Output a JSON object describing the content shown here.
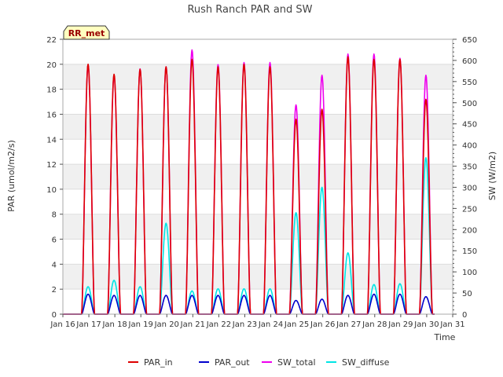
{
  "chart_data": {
    "type": "line",
    "title": "Rush Ranch PAR and SW",
    "badge": "RR_met",
    "xlabel": "Time",
    "ylabel": "PAR (umol/m2/s)",
    "y2label": "SW (W/m2)",
    "xlim": [
      16,
      31
    ],
    "ylim": [
      0,
      22
    ],
    "y2lim": [
      0,
      650
    ],
    "xticks": [
      16,
      17,
      18,
      19,
      20,
      21,
      22,
      23,
      24,
      25,
      26,
      27,
      28,
      29,
      30,
      31
    ],
    "xtick_labels": [
      "Jan 16",
      "Jan 17",
      "Jan 18",
      "Jan 19",
      "Jan 20",
      "Jan 21",
      "Jan 22",
      "Jan 23",
      "Jan 24",
      "Jan 25",
      "Jan 26",
      "Jan 27",
      "Jan 28",
      "Jan 29",
      "Jan 30",
      "Jan 31"
    ],
    "yticks": [
      0,
      2,
      4,
      6,
      8,
      10,
      12,
      14,
      16,
      18,
      20,
      22
    ],
    "y2ticks": [
      0,
      50,
      100,
      150,
      200,
      250,
      300,
      350,
      400,
      450,
      500,
      550,
      600,
      650
    ],
    "grid": true,
    "legend_position": "bottom",
    "days": [
      17,
      18,
      19,
      20,
      21,
      22,
      23,
      24,
      25,
      26,
      27,
      28,
      29,
      30
    ],
    "series": [
      {
        "name": "PAR_in",
        "axis": "left",
        "color": "#dd0000",
        "day_peaks": [
          20.0,
          19.2,
          19.6,
          19.8,
          20.4,
          19.8,
          20.0,
          19.8,
          15.6,
          16.4,
          20.6,
          20.4,
          20.4,
          17.2
        ]
      },
      {
        "name": "PAR_out",
        "axis": "left",
        "color": "#0000cc",
        "day_peaks": [
          1.6,
          1.5,
          1.5,
          1.5,
          1.5,
          1.5,
          1.5,
          1.5,
          1.1,
          1.2,
          1.5,
          1.6,
          1.6,
          1.4
        ]
      },
      {
        "name": "SW_total",
        "axis": "right",
        "color": "#ee00ee",
        "day_peaks": [
          590,
          565,
          580,
          585,
          625,
          590,
          595,
          595,
          495,
          565,
          615,
          615,
          605,
          565
        ]
      },
      {
        "name": "SW_diffuse",
        "axis": "right",
        "color": "#00e5e5",
        "day_peaks": [
          65,
          80,
          65,
          215,
          55,
          60,
          60,
          60,
          240,
          300,
          145,
          70,
          72,
          370
        ]
      }
    ]
  }
}
